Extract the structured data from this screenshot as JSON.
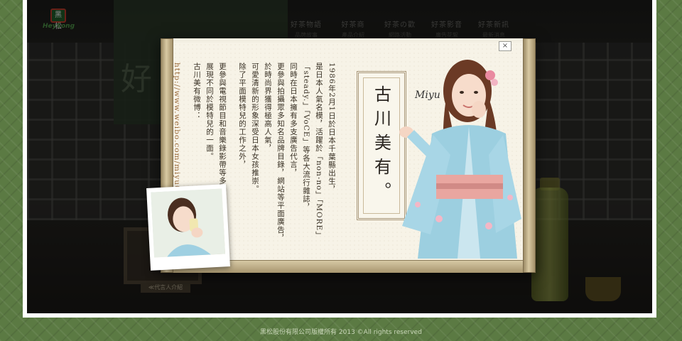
{
  "brand": {
    "logo_text": "HeySong",
    "logo_mark": "黑松"
  },
  "nav": {
    "items": [
      {
        "label": "好茶物語",
        "sub": "品牌故事"
      },
      {
        "label": "好茶商",
        "sub": "產品介紹"
      },
      {
        "label": "好茶の歡",
        "sub": "網路活動"
      },
      {
        "label": "好茶影音",
        "sub": "廣告花絮"
      },
      {
        "label": "好茶新訊",
        "sub": "最新消息"
      }
    ]
  },
  "background": {
    "banner_char": "好",
    "frame_label": "≪代言人介紹"
  },
  "modal": {
    "close_label": "×",
    "name": "古川美有。",
    "signature": "Miyu",
    "bio_columns": [
      "1986年2月1日於日本千葉縣出生，",
      "是日本人氣名模，活躍於「non-no」「MORE」",
      "「steady.」「VoCE」等各大流行雜誌，",
      "同時在日本擁有多支廣告代言，",
      "更參與拍攝眾多知名品牌目錄，網站等平面廣告，",
      "於時尚界獲得極高人氣，",
      "可愛清新的形象深受日本女孩推崇。",
      "除了平面模特兒的工作之外，",
      "更參與電視節目和音樂錄影帶等多元演出",
      "展現不同於模特兒的一面。",
      "古川美有微博：",
      "http://www.weibo.com/miyu0201"
    ]
  },
  "footer": {
    "copyright": "黑松股份有限公司版權所有 2013 ©All rights reserved"
  },
  "colors": {
    "page_bg": "#5b7a43",
    "paper": "#f7f3e7",
    "rod": "#d8c9a2",
    "kimono": "#9ccfe0",
    "obi": "#e9a6a0"
  }
}
